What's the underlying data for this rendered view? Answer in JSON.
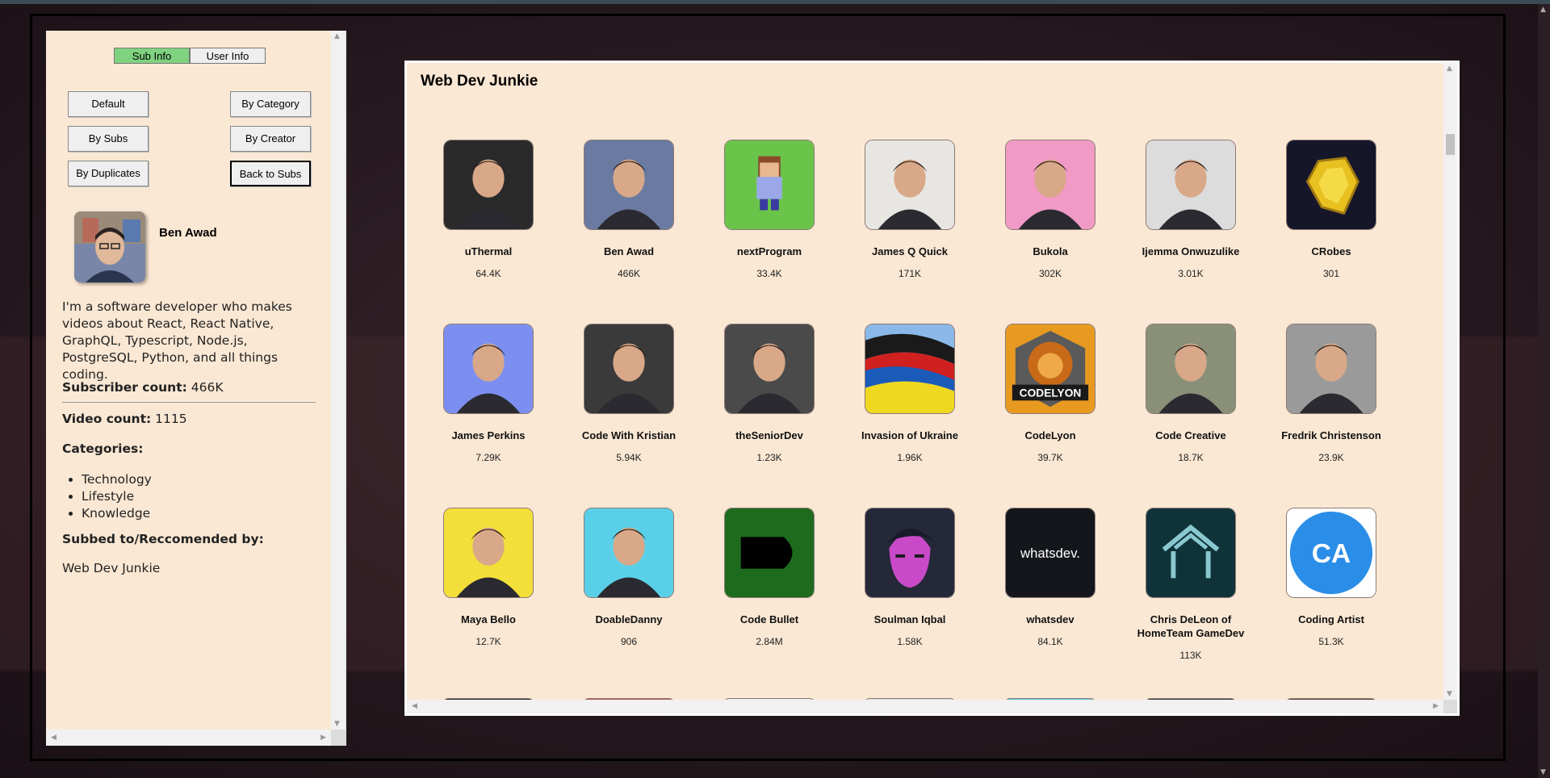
{
  "left_panel": {
    "tabs": [
      {
        "label": "Sub Info",
        "active": true
      },
      {
        "label": "User Info",
        "active": false
      }
    ],
    "sort_buttons": {
      "default": "Default",
      "by_category": "By Category",
      "by_subs": "By Subs",
      "by_creator": "By Creator",
      "by_duplicates": "By Duplicates",
      "back_to_subs": "Back to Subs"
    },
    "profile": {
      "name": "Ben Awad",
      "description": "I'm a software developer who makes videos about React, React Native, GraphQL, Typescript, Node.js, PostgreSQL, Python, and all things coding.",
      "subscriber_label": "Subscriber count:",
      "subscriber_value": "466K",
      "video_label": "Video count:",
      "video_value": "1115",
      "categories_label": "Categories:",
      "categories": [
        "Technology",
        "Lifestyle",
        "Knowledge"
      ],
      "subbed_label": "Subbed to/Reccomended by:",
      "subbed_value": "Web Dev Junkie"
    }
  },
  "main_panel": {
    "title": "Web Dev Junkie",
    "channels": [
      {
        "name": "uThermal",
        "count": "64.4K",
        "icon": "person-photo",
        "bg": "#2a2a2a"
      },
      {
        "name": "Ben Awad",
        "count": "466K",
        "icon": "person-photo",
        "bg": "#6a7aa0"
      },
      {
        "name": "nextProgram",
        "count": "33.4K",
        "icon": "pixel-character",
        "bg": "#6ac44a"
      },
      {
        "name": "James Q Quick",
        "count": "171K",
        "icon": "person-photo",
        "bg": "#e8e6e2"
      },
      {
        "name": "Bukola",
        "count": "302K",
        "icon": "person-photo",
        "bg": "#f29ac6"
      },
      {
        "name": "Ijemma Onwuzulike",
        "count": "3.01K",
        "icon": "person-photo",
        "bg": "#dcdcdc"
      },
      {
        "name": "CRobes",
        "count": "301",
        "icon": "gold-crystal",
        "bg": "#15162a"
      },
      {
        "name": "James Perkins",
        "count": "7.29K",
        "icon": "person-photo",
        "bg": "#7c8ff0"
      },
      {
        "name": "Code With Kristian",
        "count": "5.94K",
        "icon": "person-photo",
        "bg": "#3a3a3a"
      },
      {
        "name": "theSeniorDev",
        "count": "1.23K",
        "icon": "person-photo",
        "bg": "#4a4a4a"
      },
      {
        "name": "Invasion of Ukraine",
        "count": "1.96K",
        "icon": "flag",
        "bg": "#3a6fc0"
      },
      {
        "name": "CodeLyon",
        "count": "39.7K",
        "icon": "lion-logo",
        "bg": "#e89a20"
      },
      {
        "name": "Code Creative",
        "count": "18.7K",
        "icon": "person-photo",
        "bg": "#8a9078"
      },
      {
        "name": "Fredrik Christenson",
        "count": "23.9K",
        "icon": "person-photo",
        "bg": "#9a9a9a"
      },
      {
        "name": "Maya Bello",
        "count": "12.7K",
        "icon": "person-photo",
        "bg": "#f3df3a"
      },
      {
        "name": "DoableDanny",
        "count": "906",
        "icon": "person-photo",
        "bg": "#5ad0e8"
      },
      {
        "name": "Code Bullet",
        "count": "2.84M",
        "icon": "bullet-logo",
        "bg": "#1e6b1e"
      },
      {
        "name": "Soulman Iqbal",
        "count": "1.58K",
        "icon": "cartoon-face",
        "bg": "#242838"
      },
      {
        "name": "whatsdev",
        "count": "84.1K",
        "icon": "text-logo",
        "bg": "#14161c"
      },
      {
        "name": "Chris DeLeon of HomeTeam GameDev",
        "count": "113K",
        "icon": "house-logo",
        "bg": "#0f3338"
      },
      {
        "name": "Coding Artist",
        "count": "51.3K",
        "icon": "ca-logo",
        "bg": "#2a8de8"
      }
    ],
    "whatsdev_logo_text": "whatsdev.",
    "codelyon_logo_text": "CODELYON",
    "coding_artist_logo_text": "CA"
  }
}
